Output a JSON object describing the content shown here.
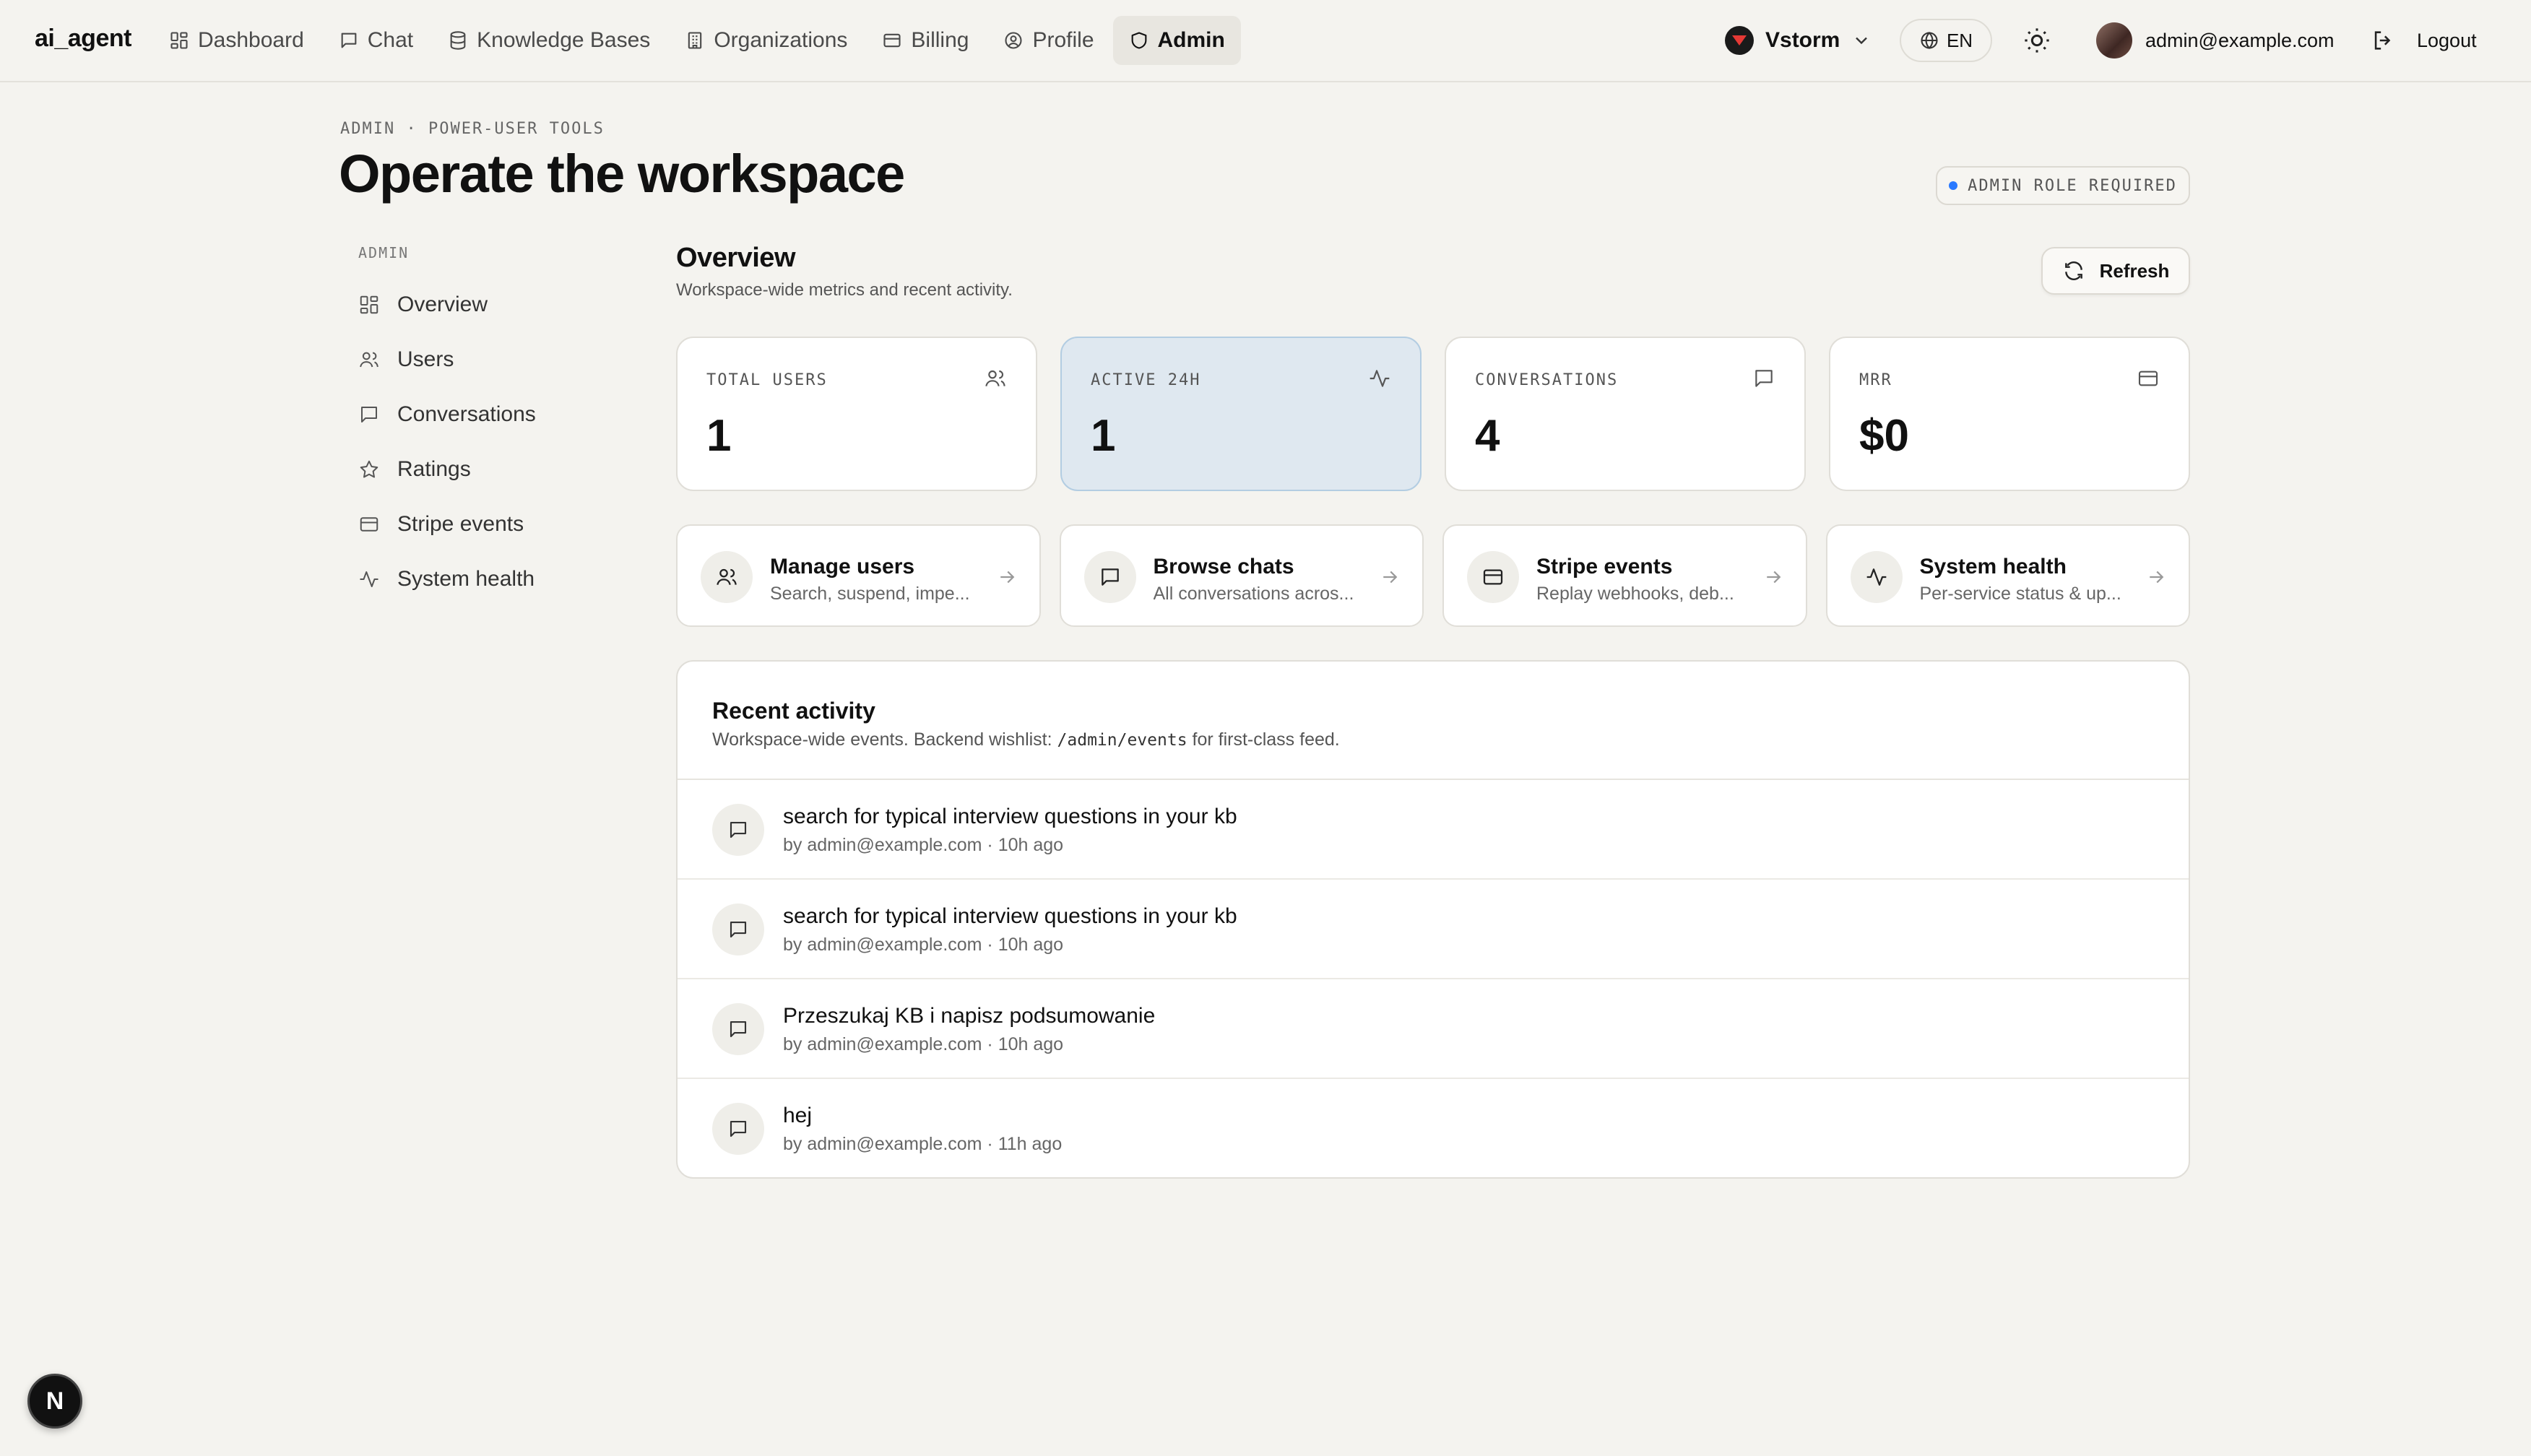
{
  "brand": "ai_agent",
  "nav": [
    {
      "label": "Dashboard",
      "icon": "dashboard-icon"
    },
    {
      "label": "Chat",
      "icon": "chat-icon"
    },
    {
      "label": "Knowledge Bases",
      "icon": "database-icon"
    },
    {
      "label": "Organizations",
      "icon": "building-icon"
    },
    {
      "label": "Billing",
      "icon": "credit-card-icon"
    },
    {
      "label": "Profile",
      "icon": "user-circle-icon"
    },
    {
      "label": "Admin",
      "icon": "shield-icon",
      "active": true
    }
  ],
  "header": {
    "org_name": "Vstorm",
    "language": "EN",
    "user_email": "admin@example.com",
    "logout_label": "Logout"
  },
  "page": {
    "eyebrow": "ADMIN · POWER-USER TOOLS",
    "title": "Operate the workspace",
    "role_badge": "ADMIN ROLE REQUIRED"
  },
  "sidebar": {
    "label": "ADMIN",
    "items": [
      {
        "label": "Overview",
        "icon": "grid-icon"
      },
      {
        "label": "Users",
        "icon": "users-icon"
      },
      {
        "label": "Conversations",
        "icon": "chat-icon"
      },
      {
        "label": "Ratings",
        "icon": "star-icon"
      },
      {
        "label": "Stripe events",
        "icon": "credit-card-icon"
      },
      {
        "label": "System health",
        "icon": "activity-icon"
      }
    ]
  },
  "overview": {
    "title": "Overview",
    "subtitle": "Workspace-wide metrics and recent activity.",
    "refresh_label": "Refresh"
  },
  "metrics": [
    {
      "label": "TOTAL USERS",
      "value": "1",
      "icon": "users-icon"
    },
    {
      "label": "ACTIVE 24H",
      "value": "1",
      "icon": "activity-icon",
      "highlight": true
    },
    {
      "label": "CONVERSATIONS",
      "value": "4",
      "icon": "chat-icon"
    },
    {
      "label": "MRR",
      "value": "$0",
      "icon": "credit-card-icon"
    }
  ],
  "actions": [
    {
      "title": "Manage users",
      "description": "Search, suspend, impe...",
      "icon": "users-icon"
    },
    {
      "title": "Browse chats",
      "description": "All conversations acros...",
      "icon": "chat-icon"
    },
    {
      "title": "Stripe events",
      "description": "Replay webhooks, deb...",
      "icon": "credit-card-icon"
    },
    {
      "title": "System health",
      "description": "Per-service status & up...",
      "icon": "activity-icon"
    }
  ],
  "activity": {
    "title": "Recent activity",
    "subtitle_prefix": "Workspace-wide events. Backend wishlist:",
    "subtitle_code": "/admin/events",
    "subtitle_suffix": "for first-class feed.",
    "items": [
      {
        "title": "search for typical interview questions in your kb",
        "meta": "by admin@example.com · 10h ago"
      },
      {
        "title": "search for typical interview questions in your kb",
        "meta": "by admin@example.com · 10h ago"
      },
      {
        "title": "Przeszukaj KB i napisz podsumowanie",
        "meta": "by admin@example.com · 10h ago"
      },
      {
        "title": "hej",
        "meta": "by admin@example.com · 11h ago"
      }
    ]
  },
  "dev_badge": "N",
  "colors": {
    "background": "#f4f3ef",
    "highlight_card": "#dfe8f0",
    "badge_dot": "#2979ff",
    "org_logo_accent": "#e53935"
  }
}
